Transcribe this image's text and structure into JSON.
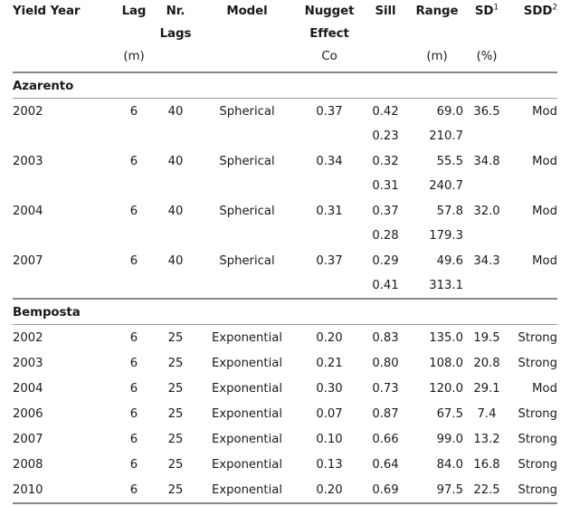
{
  "table": {
    "header": {
      "row1": [
        "Yield Year",
        "Lag",
        "Nr.",
        "Model",
        "Nugget",
        "Sill",
        "Range",
        "SD",
        "SDD"
      ],
      "row2": [
        "",
        "",
        "Lags",
        "",
        "Effect",
        "",
        "",
        "",
        ""
      ],
      "row3": [
        "",
        "(m)",
        "",
        "",
        "Co",
        "",
        "(m)",
        "(%)",
        ""
      ],
      "superscripts": {
        "sd": "1",
        "sdd": "2"
      }
    },
    "groups": [
      {
        "name": "Azarento",
        "rows": [
          {
            "year": "2002",
            "lag": "6",
            "nlags": "40",
            "model": "Spherical",
            "nugget": "0.37",
            "sill": "0.42",
            "range": "69.0",
            "sd": "36.5",
            "sdd": "Mod",
            "extra": {
              "sill": "0.23",
              "range": "210.7"
            }
          },
          {
            "year": "2003",
            "lag": "6",
            "nlags": "40",
            "model": "Spherical",
            "nugget": "0.34",
            "sill": "0.32",
            "range": "55.5",
            "sd": "34.8",
            "sdd": "Mod",
            "extra": {
              "sill": "0.31",
              "range": "240.7"
            }
          },
          {
            "year": "2004",
            "lag": "6",
            "nlags": "40",
            "model": "Spherical",
            "nugget": "0.31",
            "sill": "0.37",
            "range": "57.8",
            "sd": "32.0",
            "sdd": "Mod",
            "extra": {
              "sill": "0.28",
              "range": "179.3"
            }
          },
          {
            "year": "2007",
            "lag": "6",
            "nlags": "40",
            "model": "Spherical",
            "nugget": "0.37",
            "sill": "0.29",
            "range": "49.6",
            "sd": "34.3",
            "sdd": "Mod",
            "extra": {
              "sill": "0.41",
              "range": "313.1"
            }
          }
        ]
      },
      {
        "name": "Bemposta",
        "rows": [
          {
            "year": "2002",
            "lag": "6",
            "nlags": "25",
            "model": "Exponential",
            "nugget": "0.20",
            "sill": "0.83",
            "range": "135.0",
            "sd": "19.5",
            "sdd": "Strong"
          },
          {
            "year": "2003",
            "lag": "6",
            "nlags": "25",
            "model": "Exponential",
            "nugget": "0.21",
            "sill": "0.80",
            "range": "108.0",
            "sd": "20.8",
            "sdd": "Strong"
          },
          {
            "year": "2004",
            "lag": "6",
            "nlags": "25",
            "model": "Exponential",
            "nugget": "0.30",
            "sill": "0.73",
            "range": "120.0",
            "sd": "29.1",
            "sdd": "Mod"
          },
          {
            "year": "2006",
            "lag": "6",
            "nlags": "25",
            "model": "Exponential",
            "nugget": "0.07",
            "sill": "0.87",
            "range": "67.5",
            "sd": "7.4",
            "sdd": "Strong"
          },
          {
            "year": "2007",
            "lag": "6",
            "nlags": "25",
            "model": "Exponential",
            "nugget": "0.10",
            "sill": "0.66",
            "range": "99.0",
            "sd": "13.2",
            "sdd": "Strong"
          },
          {
            "year": "2008",
            "lag": "6",
            "nlags": "25",
            "model": "Exponential",
            "nugget": "0.13",
            "sill": "0.64",
            "range": "84.0",
            "sd": "16.8",
            "sdd": "Strong"
          },
          {
            "year": "2010",
            "lag": "6",
            "nlags": "25",
            "model": "Exponential",
            "nugget": "0.20",
            "sill": "0.69",
            "range": "97.5",
            "sd": "22.5",
            "sdd": "Strong"
          }
        ]
      }
    ],
    "colors": {
      "rule": "#878787",
      "text": "#1a1a1a"
    }
  }
}
